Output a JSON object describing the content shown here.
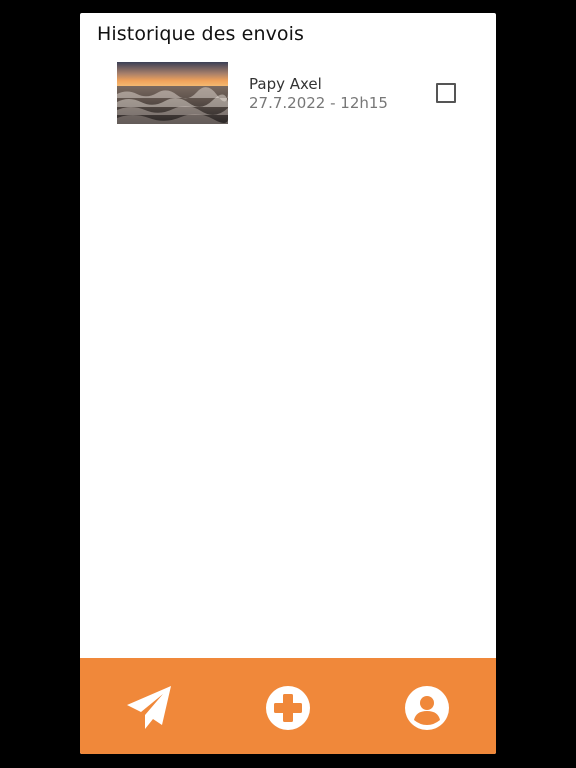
{
  "header": {
    "title": "Historique des envois"
  },
  "history": {
    "items": [
      {
        "name": "Papy Axel",
        "date": "27.7.2022 - 12h15",
        "thumbnail": "sunset-dunes-photo",
        "checked": false
      }
    ]
  },
  "bottom_nav": {
    "items": [
      {
        "icon": "send-icon"
      },
      {
        "icon": "add-icon"
      },
      {
        "icon": "profile-icon"
      }
    ]
  },
  "colors": {
    "accent": "#f0883a",
    "background": "#ffffff",
    "frame": "#000000",
    "title_text": "#111111",
    "secondary_text": "#777777"
  }
}
